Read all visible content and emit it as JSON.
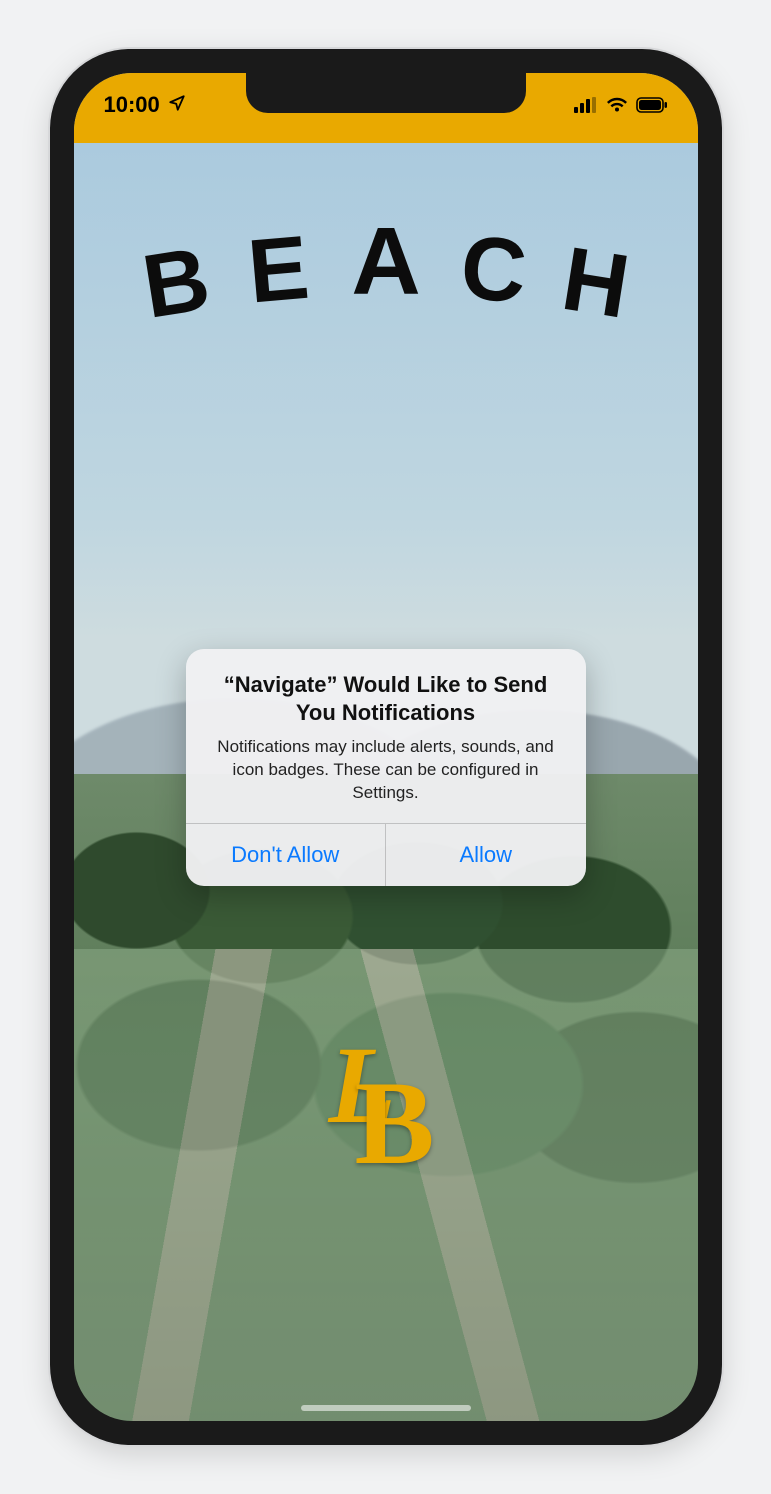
{
  "colors": {
    "brand": "#e9a900",
    "ios_blue": "#0a7aff"
  },
  "status_bar": {
    "time": "10:00"
  },
  "brand": {
    "wordmark_letters": [
      "B",
      "E",
      "A",
      "C",
      "H"
    ],
    "monogram_letters": [
      "L",
      "B"
    ]
  },
  "alert": {
    "title": "“Navigate” Would Like to Send You Notifications",
    "message": "Notifications may include alerts, sounds, and icon badges. These can be configured in Settings.",
    "deny_label": "Don't Allow",
    "allow_label": "Allow"
  }
}
